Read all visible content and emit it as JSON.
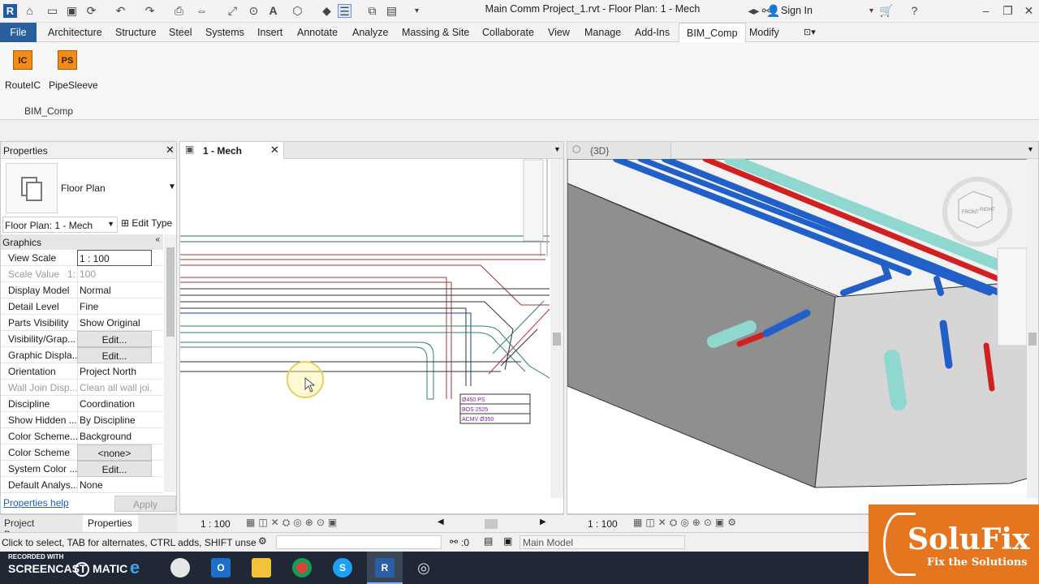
{
  "window": {
    "title": "Main Comm Project_1.rvt - Floor Plan: 1 - Mech",
    "sign_in": "Sign In"
  },
  "menu": {
    "file": "File",
    "tabs": [
      "Architecture",
      "Structure",
      "Steel",
      "Systems",
      "Insert",
      "Annotate",
      "Analyze",
      "Massing & Site",
      "Collaborate",
      "View",
      "Manage",
      "Add-Ins",
      "BIM_Comp",
      "Modify"
    ]
  },
  "ribbon": {
    "buttons": [
      {
        "icon_text": "IC",
        "label": "RouteIC"
      },
      {
        "icon_text": "PS",
        "label": "PipeSleeve"
      }
    ],
    "panel_name": "BIM_Comp"
  },
  "properties": {
    "title": "Properties",
    "type_name": "Floor Plan",
    "instance_selector": "Floor Plan: 1 - Mech",
    "edit_type": "Edit Type",
    "group": "Graphics",
    "rows": [
      {
        "key": "View Scale",
        "value": "1 : 100"
      },
      {
        "key": "Scale Value",
        "prefix": "1:",
        "value": "100"
      },
      {
        "key": "Display Model",
        "value": "Normal"
      },
      {
        "key": "Detail Level",
        "value": "Fine"
      },
      {
        "key": "Parts Visibility",
        "value": "Show Original"
      },
      {
        "key": "Visibility/Grap...",
        "value": "Edit..."
      },
      {
        "key": "Graphic Displa...",
        "value": "Edit..."
      },
      {
        "key": "Orientation",
        "value": "Project North"
      },
      {
        "key": "Wall Join Disp...",
        "value": "Clean all wall joi..."
      },
      {
        "key": "Discipline",
        "value": "Coordination"
      },
      {
        "key": "Show Hidden ...",
        "value": "By Discipline"
      },
      {
        "key": "Color Scheme...",
        "value": "Background"
      },
      {
        "key": "Color Scheme",
        "value": "<none>"
      },
      {
        "key": "System Color ...",
        "value": "Edit..."
      },
      {
        "key": "Default Analys...",
        "value": "None"
      }
    ],
    "help": "Properties help",
    "apply": "Apply",
    "bottom_tabs": [
      "Project Browser...",
      "Properties"
    ]
  },
  "views": {
    "plan_tab": "1 - Mech",
    "plan_scale": "1 : 100",
    "tag_lines": [
      "Ø450 PS",
      "BOS 2525",
      "ACMV Ø350"
    ],
    "threed_tab": "{3D}",
    "threed_scale": "1 : 100",
    "viewcube": [
      "FRONT",
      "RIGHT"
    ]
  },
  "statusbar": {
    "hint": "Click to select, TAB for alternates, CTRL adds, SHIFT unselects.",
    "count": ":0",
    "model": "Main Model"
  },
  "taskbar": {
    "recorder_line1": "RECORDED WITH",
    "recorder_line2": "SCREENCAST",
    "recorder_line3": "MATIC"
  },
  "brand": {
    "name": "SoluFix",
    "tagline": "Fix the Solutions",
    "color": "#e5751f"
  }
}
